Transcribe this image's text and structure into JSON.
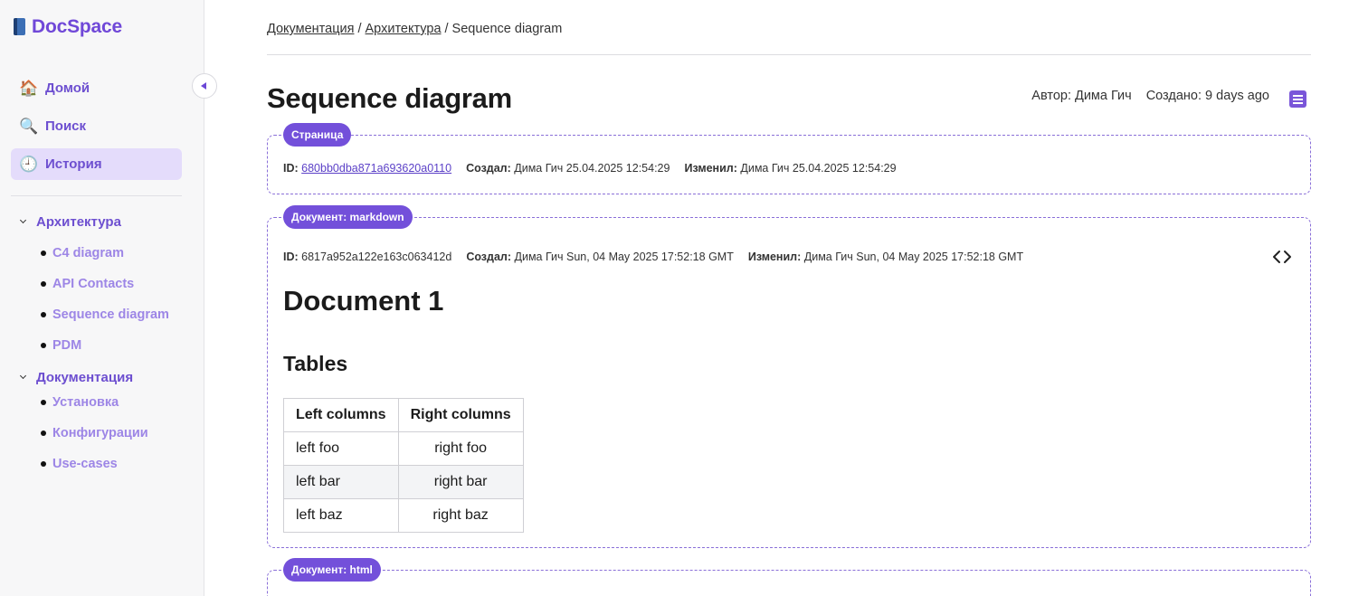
{
  "app": {
    "name": "DocSpace"
  },
  "sidebar": {
    "nav": [
      {
        "label": "Домой",
        "icon": "house-icon"
      },
      {
        "label": "Поиск",
        "icon": "magnifier-icon"
      },
      {
        "label": "История",
        "icon": "clock-icon",
        "active": true
      }
    ],
    "tree": [
      {
        "label": "Архитектура",
        "children": [
          "C4 diagram",
          "API Contacts",
          "Sequence diagram",
          "PDM"
        ]
      },
      {
        "label": "Документация",
        "children": [
          "Установка",
          "Конфигурации",
          "Use-cases"
        ]
      }
    ]
  },
  "breadcrumb": {
    "items": [
      "Документация",
      "Архитектура",
      "Sequence diagram"
    ],
    "separator": "/"
  },
  "page": {
    "title": "Sequence diagram",
    "author": "Автор: Дима Гич",
    "created": "Создано: 9 days ago"
  },
  "cards": {
    "page": {
      "tag": "Страница",
      "id_label": "ID:",
      "id_value": "680bb0dba871a693620a0110",
      "created_label": "Создал:",
      "created_value": "Дима Гич 25.04.2025 12:54:29",
      "modified_label": "Изменил:",
      "modified_value": "Дима Гич 25.04.2025 12:54:29"
    },
    "markdown": {
      "tag": "Документ: markdown",
      "id_label": "ID:",
      "id_value": "6817a952a122e163c063412d",
      "created_label": "Создал:",
      "created_value": "Дима Гич Sun, 04 May 2025 17:52:18 GMT",
      "modified_label": "Изменил:",
      "modified_value": "Дима Гич Sun, 04 May 2025 17:52:18 GMT",
      "heading": "Document 1",
      "subheading": "Tables",
      "table": {
        "headers": [
          "Left columns",
          "Right columns"
        ],
        "rows": [
          [
            "left foo",
            "right foo"
          ],
          [
            "left bar",
            "right bar"
          ],
          [
            "left baz",
            "right baz"
          ]
        ]
      }
    },
    "html": {
      "tag": "Документ: html"
    }
  },
  "colors": {
    "accent": "#7350da",
    "nav_text": "#6d4fd0",
    "active_bg": "#e4dcfb",
    "tree_child": "#9d86e6"
  }
}
